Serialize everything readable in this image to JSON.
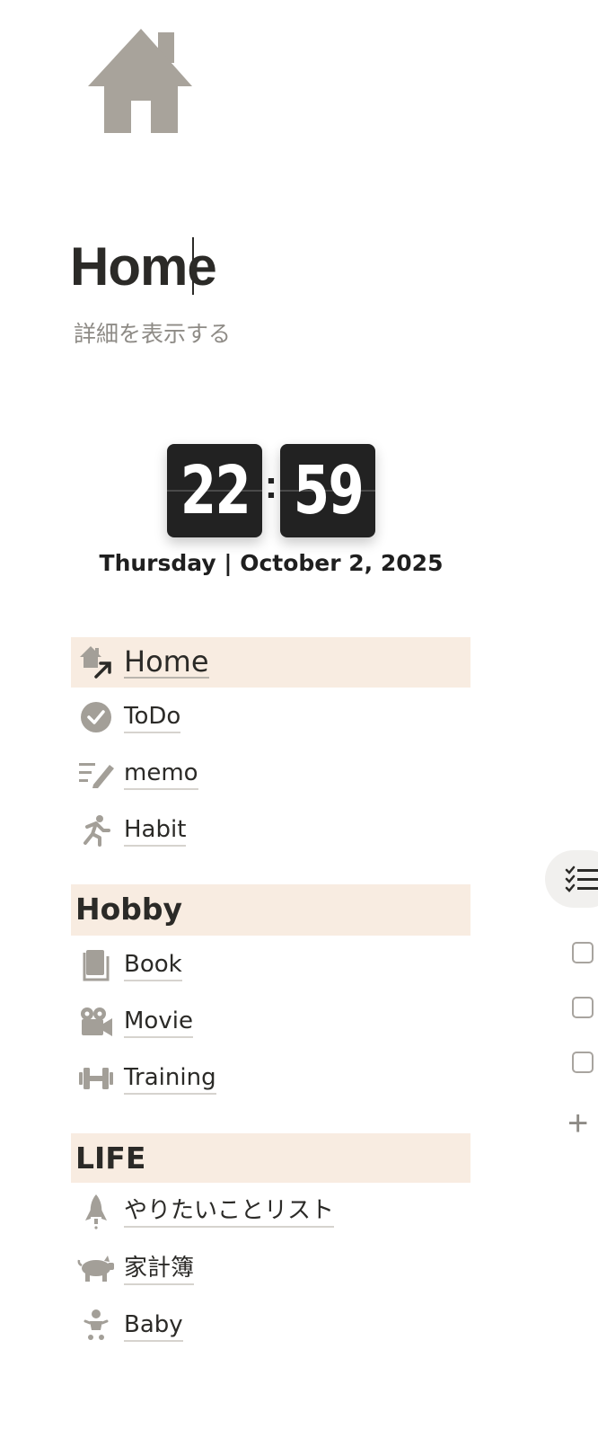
{
  "page": {
    "title": "Home",
    "subtitle": "詳細を表示する",
    "icon": "house-icon"
  },
  "clock": {
    "hours": "22",
    "separator": ":",
    "minutes": "59",
    "date": "Thursday | October 2, 2025"
  },
  "nav": {
    "main": [
      {
        "label": "Home",
        "icon": "house-link-icon"
      },
      {
        "label": "ToDo",
        "icon": "checkmark-circle-icon"
      },
      {
        "label": "memo",
        "icon": "note-pencil-icon"
      },
      {
        "label": "Habit",
        "icon": "running-person-icon"
      }
    ],
    "hobby": {
      "title": "Hobby",
      "items": [
        {
          "label": "Book",
          "icon": "book-icon"
        },
        {
          "label": "Movie",
          "icon": "movie-camera-icon"
        },
        {
          "label": "Training",
          "icon": "dumbbell-icon"
        }
      ]
    },
    "life": {
      "title": "LIFE",
      "items": [
        {
          "label": "やりたいことリスト",
          "icon": "rocket-icon"
        },
        {
          "label": "家計簿",
          "icon": "piggy-bank-icon"
        },
        {
          "label": "Baby",
          "icon": "baby-icon"
        }
      ]
    }
  },
  "colors": {
    "highlight": "#f8ece1",
    "icon_gray": "#a39f98",
    "text": "#2b2a27"
  }
}
